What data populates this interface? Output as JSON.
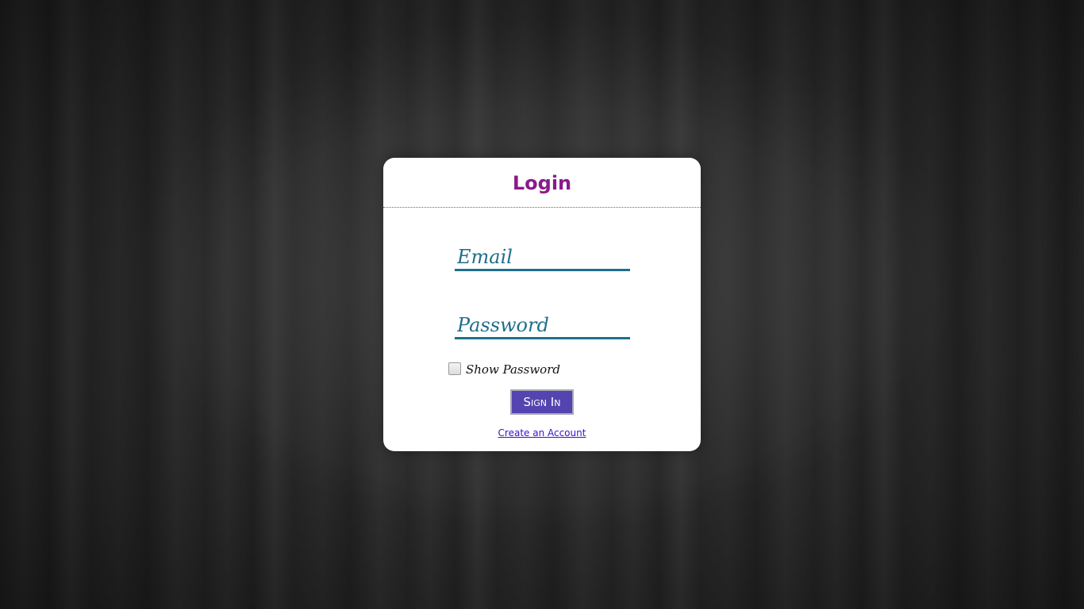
{
  "login_card": {
    "title": "Login",
    "email_placeholder": "Email",
    "password_placeholder": "Password",
    "show_password_label": "Show Password",
    "show_password_checked": false,
    "sign_in_label": "Sign In",
    "create_account_label": "Create an Account"
  },
  "colors": {
    "title": "#8b1a8b",
    "field_text_and_underline": "#1f6f8b",
    "sign_in_button": "#5444b0",
    "link": "#3b0fd0",
    "header_divider": "#b84a5c",
    "background": "#2b2b2b"
  },
  "icons": {
    "show_password_checkbox": "checkbox-unchecked-icon"
  }
}
